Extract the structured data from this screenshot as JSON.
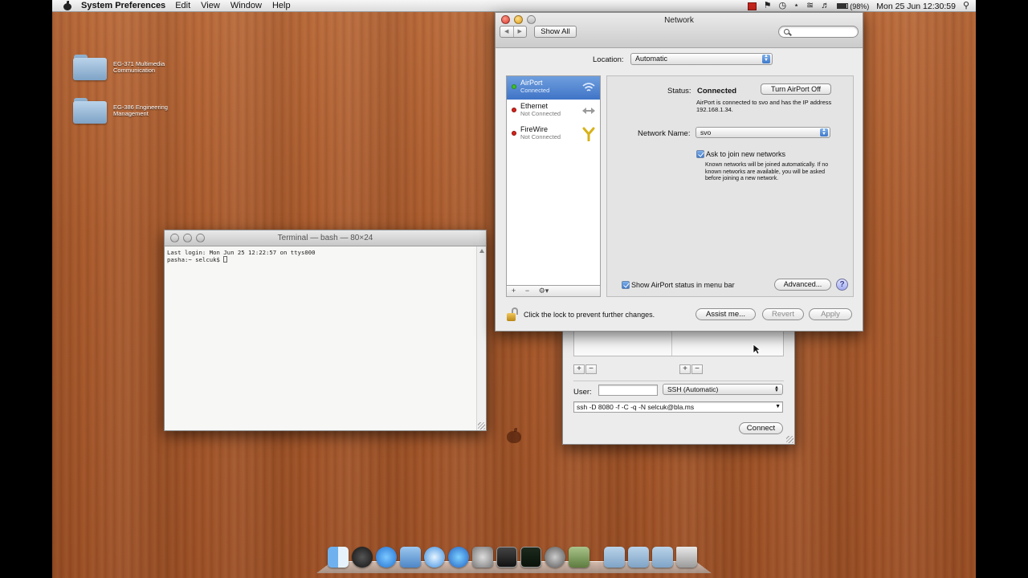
{
  "menubar": {
    "app_name": "System Preferences",
    "menus": [
      "Edit",
      "View",
      "Window",
      "Help"
    ],
    "battery": "(98%)",
    "clock": "Mon 25 Jun  12:30:59"
  },
  "desktop": {
    "items": [
      {
        "label": "EG-371 Multimedia Communication"
      },
      {
        "label": "EG-386 Engineering Management"
      }
    ]
  },
  "terminal": {
    "title": "Terminal — bash — 80×24",
    "line1": "Last login: Mon Jun 25 12:22:57 on ttys000",
    "prompt": "pasha:~ selcuk$ "
  },
  "ssh_window": {
    "user_label": "User:",
    "user_value": "",
    "mode": "SSH (Automatic)",
    "command": "ssh -D 8080 -f -C -q -N selcuk@bla.ms",
    "add_label": "+",
    "remove_label": "−",
    "connect_label": "Connect"
  },
  "network": {
    "title": "Network",
    "show_all": "Show All",
    "search_placeholder": "",
    "location_label": "Location:",
    "location_value": "Automatic",
    "services": [
      {
        "name": "AirPort",
        "status": "Connected",
        "state": "connected",
        "icon": "wifi-icon"
      },
      {
        "name": "Ethernet",
        "status": "Not Connected",
        "state": "disconnected",
        "icon": "ethernet-icon"
      },
      {
        "name": "FireWire",
        "status": "Not Connected",
        "state": "disconnected",
        "icon": "firewire-icon"
      }
    ],
    "status_label": "Status:",
    "status_value": "Connected",
    "turn_off_label": "Turn AirPort Off",
    "status_detail": "AirPort is connected to svo and has the IP address 192.168.1.34.",
    "network_name_label": "Network Name:",
    "network_name_value": "svo",
    "ask_join_label": "Ask to join new networks",
    "ask_join_checked": true,
    "ask_join_help": "Known networks will be joined automatically. If no known networks are available, you will be asked before joining a new network.",
    "show_status_label": "Show AirPort status in menu bar",
    "show_status_checked": true,
    "advanced_label": "Advanced...",
    "help_label": "?",
    "lock_text": "Click the lock to prevent further changes.",
    "assist_label": "Assist me...",
    "revert_label": "Revert",
    "apply_label": "Apply"
  },
  "dock": {
    "icons": [
      "finder-icon",
      "dashboard-icon",
      "app-store-icon",
      "preview-icon",
      "safari-icon",
      "itunes-icon",
      "system-preferences-icon",
      "terminal-icon",
      "activity-monitor-icon",
      "bbedit-icon",
      "script-editor-icon",
      "applications-folder-icon",
      "documents-folder-icon",
      "downloads-folder-icon",
      "trash-icon"
    ]
  },
  "colors": {
    "selection_blue": "#3f74c7",
    "connected_green": "#3fbf2b",
    "disconnected_red": "#d4241b"
  }
}
